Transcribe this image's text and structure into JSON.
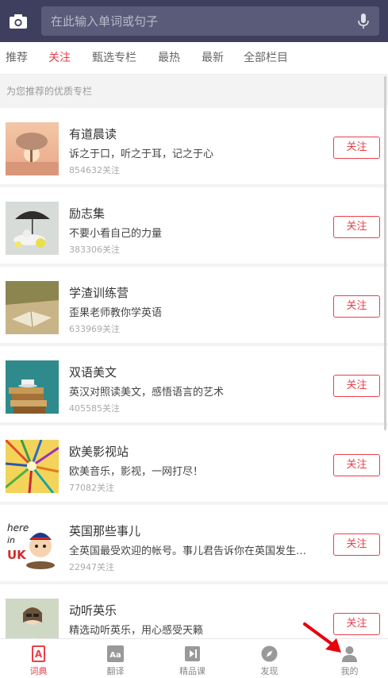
{
  "search": {
    "placeholder": "在此输入单词或句子",
    "camera_icon": "camera-icon",
    "mic_icon": "microphone-icon"
  },
  "tabs": [
    {
      "label": "推荐",
      "active": false
    },
    {
      "label": "关注",
      "active": true
    },
    {
      "label": "甄选专栏",
      "active": false
    },
    {
      "label": "最热",
      "active": false
    },
    {
      "label": "最新",
      "active": false
    },
    {
      "label": "全部栏目",
      "active": false
    }
  ],
  "section": {
    "title": "为您推荐的优质专栏"
  },
  "items": [
    {
      "title": "有道晨读",
      "desc": "诉之于口，听之于耳，记之于心",
      "count": "854632关注",
      "follow": "关注"
    },
    {
      "title": "励志集",
      "desc": "不要小看自己的力量",
      "count": "383306关注",
      "follow": "关注"
    },
    {
      "title": "学渣训练营",
      "desc": "歪果老师教你学英语",
      "count": "633969关注",
      "follow": "关注"
    },
    {
      "title": "双语美文",
      "desc": "英汉对照读美文，感悟语言的艺术",
      "count": "405585关注",
      "follow": "关注"
    },
    {
      "title": "欧美影视站",
      "desc": "欧美音乐，影视，一网打尽！",
      "count": "77082关注",
      "follow": "关注"
    },
    {
      "title": "英国那些事儿",
      "desc": "全英国最受欢迎的帐号。事儿君告诉你在英国发生的事儿",
      "count": "22947关注",
      "follow": "关注",
      "thumb_text": [
        "here",
        "in",
        "UK"
      ]
    },
    {
      "title": "动听英乐",
      "desc": "精选动听英乐，用心感受天籁",
      "count": "",
      "follow": "关注"
    }
  ],
  "bottom_nav": [
    {
      "label": "词典",
      "icon": "dictionary-icon",
      "active": true,
      "glyph": "A"
    },
    {
      "label": "翻译",
      "icon": "translate-icon",
      "active": false,
      "glyph": "Aa"
    },
    {
      "label": "精品课",
      "icon": "course-icon",
      "active": false
    },
    {
      "label": "发现",
      "icon": "compass-icon",
      "active": false
    },
    {
      "label": "我的",
      "icon": "profile-icon",
      "active": false
    }
  ],
  "colors": {
    "header": "#3e3f5e",
    "accent": "#e8404a",
    "annotation_arrow": "#e8000b"
  }
}
